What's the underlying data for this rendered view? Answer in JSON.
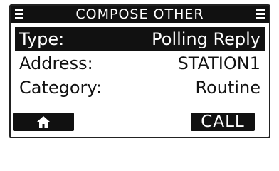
{
  "screen": {
    "title": "COMPOSE OTHER",
    "left_menu_icon": "menu-lines-icon",
    "right_menu_icon": "menu-lines-icon"
  },
  "fields": [
    {
      "label": "Type:",
      "value": "Polling Reply",
      "selected": true
    },
    {
      "label": "Address:",
      "value": "STATION1",
      "selected": false
    },
    {
      "label": "Category:",
      "value": "Routine",
      "selected": false
    }
  ],
  "softkeys": {
    "left_icon": "home-icon",
    "right_label": "CALL"
  },
  "colors": {
    "background": "#ffffff",
    "foreground": "#111111",
    "inverse_text": "#ffffff"
  }
}
